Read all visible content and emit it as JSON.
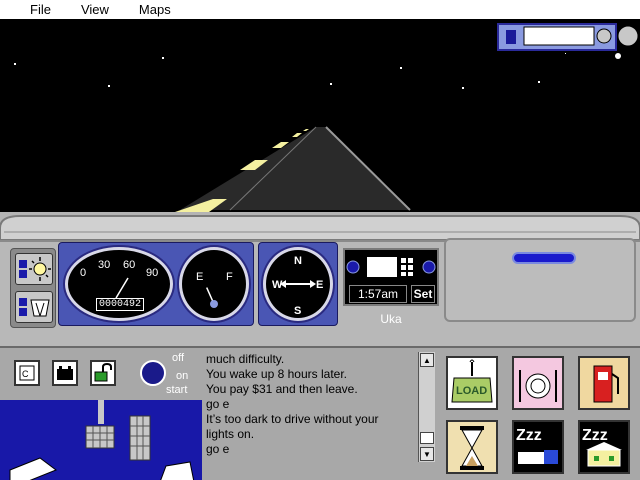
{
  "menu": {
    "file": "File",
    "view": "View",
    "maps": "Maps"
  },
  "odometer": "0000492",
  "speedometer": {
    "labels": [
      "0",
      "30",
      "60",
      "90"
    ],
    "speed": 0
  },
  "fuel_gauge": {
    "empty_label": "E",
    "full_label": "F",
    "level": 0.3
  },
  "compass": {
    "n": "N",
    "s": "S",
    "e": "E",
    "w": "W",
    "heading": "east"
  },
  "clock": {
    "time": "1:57am",
    "set_label": "Set"
  },
  "location": "Uka",
  "toggle": {
    "off": "off",
    "on": "on",
    "start": "start"
  },
  "log": [
    "much difficulty.",
    "You wake up 8 hours later.",
    "You pay $31 and then leave.",
    "go e",
    "It’s too dark to drive without your",
    "lights on.",
    "go e"
  ],
  "actions": {
    "load_label": "LOAD",
    "sleep_label": "Zzz"
  },
  "colors": {
    "sky": "#000000",
    "dash_blue": "#4a56b4",
    "pedal_bg": "#1818a8",
    "road_line": "#f4f0a0"
  },
  "icons": [
    "headlights-icon",
    "wipers-icon",
    "cigarette-lighter-icon",
    "car-battery-icon",
    "lock-icon",
    "load-cargo-icon",
    "food-icon",
    "gas-pump-icon",
    "hourglass-icon",
    "sleep-truck-icon",
    "sleep-motel-icon"
  ]
}
